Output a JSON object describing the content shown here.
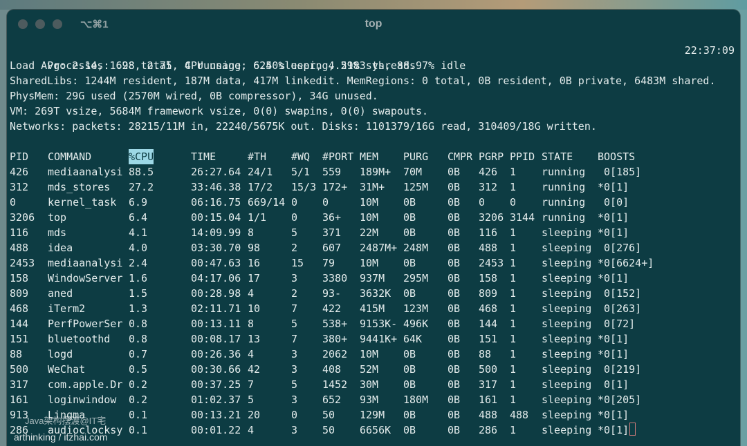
{
  "window": {
    "shortcut": "⌥⌘1",
    "title": "top"
  },
  "summary": {
    "processes": "Processes: 628 total, 4 running, 624 sleeping, 2983 threads",
    "clock": "22:37:09",
    "load": "Load Avg: 2.14, 1.98, 2.75  CPU usage: 6.50% user, 4.51% sys, 88.97% idle",
    "sharedlibs": "SharedLibs: 1244M resident, 187M data, 417M linkedit. MemRegions: 0 total, 0B resident, 0B private, 6483M shared.",
    "physmem": "PhysMem: 29G used (2570M wired, 0B compressor), 34G unused.",
    "vm": "VM: 269T vsize, 5684M framework vsize, 0(0) swapins, 0(0) swapouts.",
    "networks": "Networks: packets: 28215/11M in, 22240/5675K out. Disks: 1101379/16G read, 310409/18G written."
  },
  "columns": {
    "pid": "PID",
    "command": "COMMAND",
    "cpu": "%CPU",
    "time": "TIME",
    "th": "#TH",
    "wq": "#WQ",
    "port": "#PORT",
    "mem": "MEM",
    "purg": "PURG",
    "cmpr": "CMPR",
    "pgrp": "PGRP",
    "ppid": "PPID",
    "state": "STATE",
    "boosts": "BOOSTS"
  },
  "processes": [
    {
      "pid": "426",
      "command": "mediaanalysi",
      "cpu": "88.5",
      "time": "26:27.64",
      "th": "24/1",
      "wq": "5/1",
      "port": "559",
      "mem": "189M+",
      "purg": "70M",
      "cmpr": "0B",
      "pgrp": "426",
      "ppid": "1",
      "state": "running",
      "boosts": " 0[185]"
    },
    {
      "pid": "312",
      "command": "mds_stores",
      "cpu": "27.2",
      "time": "33:46.38",
      "th": "17/2",
      "wq": "15/3",
      "port": "172+",
      "mem": "31M+",
      "purg": "125M",
      "cmpr": "0B",
      "pgrp": "312",
      "ppid": "1",
      "state": "running",
      "boosts": "*0[1]"
    },
    {
      "pid": "0",
      "command": "kernel_task",
      "cpu": "6.9",
      "time": "06:16.75",
      "th": "669/14",
      "wq": "0",
      "port": "0",
      "mem": "10M",
      "purg": "0B",
      "cmpr": "0B",
      "pgrp": "0",
      "ppid": "0",
      "state": "running",
      "boosts": " 0[0]"
    },
    {
      "pid": "3206",
      "command": "top",
      "cpu": "6.4",
      "time": "00:15.04",
      "th": "1/1",
      "wq": "0",
      "port": "36+",
      "mem": "10M",
      "purg": "0B",
      "cmpr": "0B",
      "pgrp": "3206",
      "ppid": "3144",
      "state": "running",
      "boosts": "*0[1]"
    },
    {
      "pid": "116",
      "command": "mds",
      "cpu": "4.1",
      "time": "14:09.99",
      "th": "8",
      "wq": "5",
      "port": "371",
      "mem": "22M",
      "purg": "0B",
      "cmpr": "0B",
      "pgrp": "116",
      "ppid": "1",
      "state": "sleeping",
      "boosts": "*0[1]"
    },
    {
      "pid": "488",
      "command": "idea",
      "cpu": "4.0",
      "time": "03:30.70",
      "th": "98",
      "wq": "2",
      "port": "607",
      "mem": "2487M+",
      "purg": "248M",
      "cmpr": "0B",
      "pgrp": "488",
      "ppid": "1",
      "state": "sleeping",
      "boosts": " 0[276]"
    },
    {
      "pid": "2453",
      "command": "mediaanalysi",
      "cpu": "2.4",
      "time": "00:47.63",
      "th": "16",
      "wq": "15",
      "port": "79",
      "mem": "10M",
      "purg": "0B",
      "cmpr": "0B",
      "pgrp": "2453",
      "ppid": "1",
      "state": "sleeping",
      "boosts": "*0[6624+]"
    },
    {
      "pid": "158",
      "command": "WindowServer",
      "cpu": "1.6",
      "time": "04:17.06",
      "th": "17",
      "wq": "3",
      "port": "3380",
      "mem": "937M",
      "purg": "295M",
      "cmpr": "0B",
      "pgrp": "158",
      "ppid": "1",
      "state": "sleeping",
      "boosts": "*0[1]"
    },
    {
      "pid": "809",
      "command": "aned",
      "cpu": "1.5",
      "time": "00:28.98",
      "th": "4",
      "wq": "2",
      "port": "93-",
      "mem": "3632K",
      "purg": "0B",
      "cmpr": "0B",
      "pgrp": "809",
      "ppid": "1",
      "state": "sleeping",
      "boosts": " 0[152]"
    },
    {
      "pid": "468",
      "command": "iTerm2",
      "cpu": "1.3",
      "time": "02:11.71",
      "th": "10",
      "wq": "7",
      "port": "422",
      "mem": "415M",
      "purg": "123M",
      "cmpr": "0B",
      "pgrp": "468",
      "ppid": "1",
      "state": "sleeping",
      "boosts": " 0[263]"
    },
    {
      "pid": "144",
      "command": "PerfPowerSer",
      "cpu": "0.8",
      "time": "00:13.11",
      "th": "8",
      "wq": "5",
      "port": "538+",
      "mem": "9153K-",
      "purg": "496K",
      "cmpr": "0B",
      "pgrp": "144",
      "ppid": "1",
      "state": "sleeping",
      "boosts": " 0[72]"
    },
    {
      "pid": "151",
      "command": "bluetoothd",
      "cpu": "0.8",
      "time": "00:08.17",
      "th": "13",
      "wq": "7",
      "port": "380+",
      "mem": "9441K+",
      "purg": "64K",
      "cmpr": "0B",
      "pgrp": "151",
      "ppid": "1",
      "state": "sleeping",
      "boosts": "*0[1]"
    },
    {
      "pid": "88",
      "command": "logd",
      "cpu": "0.7",
      "time": "00:26.36",
      "th": "4",
      "wq": "3",
      "port": "2062",
      "mem": "10M",
      "purg": "0B",
      "cmpr": "0B",
      "pgrp": "88",
      "ppid": "1",
      "state": "sleeping",
      "boosts": "*0[1]"
    },
    {
      "pid": "500",
      "command": "WeChat",
      "cpu": "0.5",
      "time": "00:30.66",
      "th": "42",
      "wq": "3",
      "port": "408",
      "mem": "52M",
      "purg": "0B",
      "cmpr": "0B",
      "pgrp": "500",
      "ppid": "1",
      "state": "sleeping",
      "boosts": " 0[219]"
    },
    {
      "pid": "317",
      "command": "com.apple.Dr",
      "cpu": "0.2",
      "time": "00:37.25",
      "th": "7",
      "wq": "5",
      "port": "1452",
      "mem": "30M",
      "purg": "0B",
      "cmpr": "0B",
      "pgrp": "317",
      "ppid": "1",
      "state": "sleeping",
      "boosts": " 0[1]"
    },
    {
      "pid": "161",
      "command": "loginwindow",
      "cpu": "0.2",
      "time": "01:02.37",
      "th": "5",
      "wq": "3",
      "port": "652",
      "mem": "93M",
      "purg": "180M",
      "cmpr": "0B",
      "pgrp": "161",
      "ppid": "1",
      "state": "sleeping",
      "boosts": "*0[205]"
    },
    {
      "pid": "913",
      "command": "Lingma",
      "cpu": "0.1",
      "time": "00:13.21",
      "th": "20",
      "wq": "0",
      "port": "50",
      "mem": "129M",
      "purg": "0B",
      "cmpr": "0B",
      "pgrp": "488",
      "ppid": "488",
      "state": "sleeping",
      "boosts": "*0[1]"
    },
    {
      "pid": "286",
      "command": "audioclocksy",
      "cpu": "0.1",
      "time": "00:01.22",
      "th": "4",
      "wq": "3",
      "port": "50",
      "mem": "6656K",
      "purg": "0B",
      "cmpr": "0B",
      "pgrp": "286",
      "ppid": "1",
      "state": "sleeping",
      "boosts": "*0[1]"
    }
  ],
  "watermarks": {
    "overlay": "Java架构摆渡@IT宅",
    "site": "arthinking / itzhai.com"
  },
  "colors": {
    "terminal_bg": "#0d3c43",
    "terminal_fg": "#e4ecec",
    "header_highlight": "#9dd8e6",
    "cursor": "#d07a7a"
  }
}
